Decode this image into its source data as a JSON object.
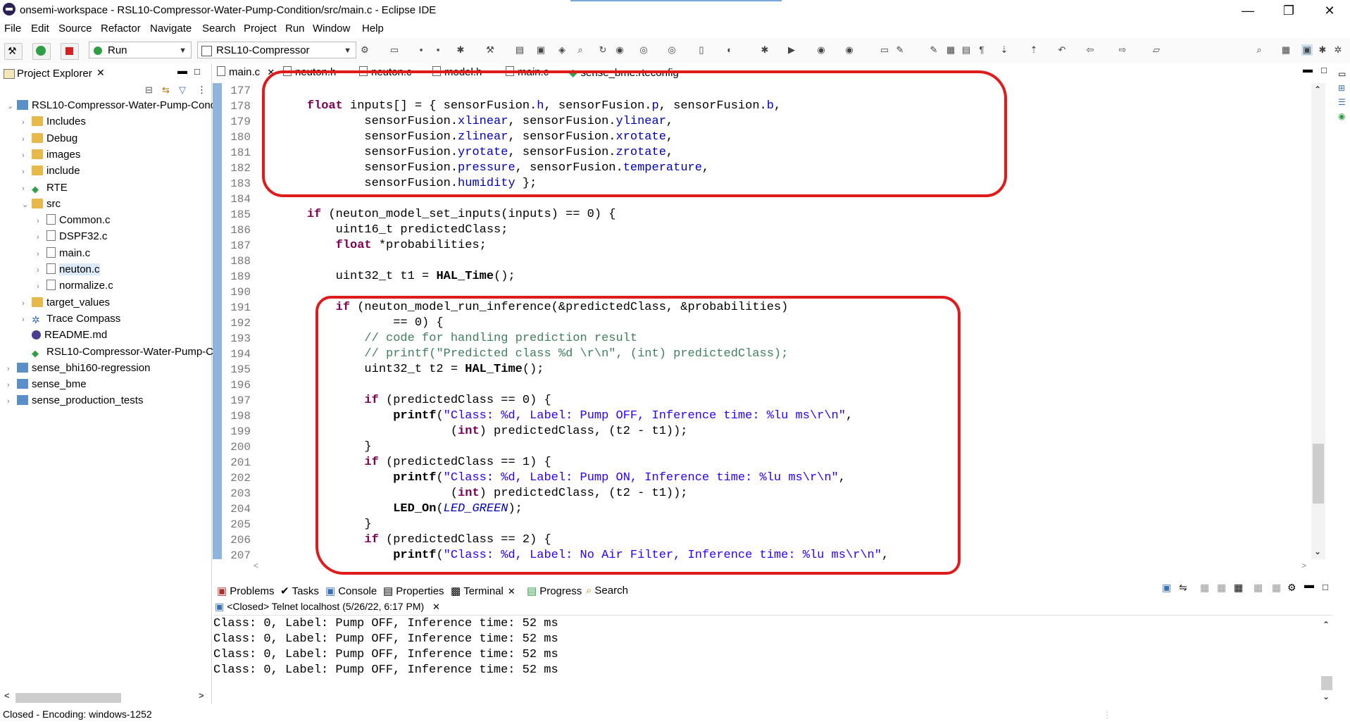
{
  "window": {
    "title": "onsemi-workspace - RSL10-Compressor-Water-Pump-Condition/src/main.c - Eclipse IDE",
    "controls": {
      "minimize": "—",
      "restore": "❐",
      "close": "✕"
    }
  },
  "menu": [
    "File",
    "Edit",
    "Source",
    "Refactor",
    "Navigate",
    "Search",
    "Project",
    "Run",
    "Window",
    "Help"
  ],
  "toolbar": {
    "run_config": "Run",
    "launch_target": "RSL10-Compressor"
  },
  "project_explorer": {
    "title": "Project Explorer",
    "items": [
      {
        "label": "RSL10-Compressor-Water-Pump-Conc",
        "kind": "project",
        "depth": 0,
        "expanded": true
      },
      {
        "label": "Includes",
        "kind": "includes",
        "depth": 1
      },
      {
        "label": "Debug",
        "kind": "folder",
        "depth": 1
      },
      {
        "label": "images",
        "kind": "folder",
        "depth": 1
      },
      {
        "label": "include",
        "kind": "folder",
        "depth": 1
      },
      {
        "label": "RTE",
        "kind": "rte",
        "depth": 1
      },
      {
        "label": "src",
        "kind": "folder",
        "depth": 1,
        "expanded": true
      },
      {
        "label": "Common.c",
        "kind": "file",
        "depth": 2
      },
      {
        "label": "DSPF32.c",
        "kind": "file",
        "depth": 2
      },
      {
        "label": "main.c",
        "kind": "file",
        "depth": 2
      },
      {
        "label": "neuton.c",
        "kind": "file",
        "depth": 2,
        "selected": true
      },
      {
        "label": "normalize.c",
        "kind": "file",
        "depth": 2
      },
      {
        "label": "target_values",
        "kind": "folder",
        "depth": 1
      },
      {
        "label": "Trace Compass",
        "kind": "trace",
        "depth": 1
      },
      {
        "label": "README.md",
        "kind": "md",
        "depth": 1
      },
      {
        "label": "RSL10-Compressor-Water-Pump-Co",
        "kind": "rteconfig",
        "depth": 1
      },
      {
        "label": "sense_bhi160-regression",
        "kind": "project",
        "depth": 0
      },
      {
        "label": "sense_bme",
        "kind": "project",
        "depth": 0
      },
      {
        "label": "sense_production_tests",
        "kind": "project",
        "depth": 0
      }
    ]
  },
  "editor_tabs": [
    "main.c",
    "neuton.h",
    "neuton.c",
    "model.h",
    "main.c",
    "sense_bme.rteconfig"
  ],
  "code_lines": [
    {
      "n": "177",
      "html": ""
    },
    {
      "n": "178",
      "html": "    <span class='kw'>float</span> inputs[] = { sensorFusion.<span class='fld'>h</span>, sensorFusion.<span class='fld'>p</span>, sensorFusion.<span class='fld'>b</span>,"
    },
    {
      "n": "179",
      "html": "            sensorFusion.<span class='fld'>xlinear</span>, sensorFusion.<span class='fld'>ylinear</span>,"
    },
    {
      "n": "180",
      "html": "            sensorFusion.<span class='fld'>zlinear</span>, sensorFusion.<span class='fld'>xrotate</span>,"
    },
    {
      "n": "181",
      "html": "            sensorFusion.<span class='fld'>yrotate</span>, sensorFusion.<span class='fld'>zrotate</span>,"
    },
    {
      "n": "182",
      "html": "            sensorFusion.<span class='fld'>pressure</span>, sensorFusion.<span class='fld'>temperature</span>,"
    },
    {
      "n": "183",
      "html": "            sensorFusion.<span class='fld'>humidity</span> };"
    },
    {
      "n": "184",
      "html": ""
    },
    {
      "n": "185",
      "html": "    <span class='kw'>if</span> (neuton_model_set_inputs(inputs) == 0) {"
    },
    {
      "n": "186",
      "html": "        uint16_t predictedClass;"
    },
    {
      "n": "187",
      "html": "        <span class='kw'>float</span> *probabilities;"
    },
    {
      "n": "188",
      "html": ""
    },
    {
      "n": "189",
      "html": "        uint32_t t1 = <span class='fn'>HAL_Time</span>();"
    },
    {
      "n": "190",
      "html": ""
    },
    {
      "n": "191",
      "html": "        <span class='kw'>if</span> (neuton_model_run_inference(&amp;predictedClass, &amp;probabilities)"
    },
    {
      "n": "192",
      "html": "                == 0) {"
    },
    {
      "n": "193",
      "html": "            <span class='cmt'>// code for handling prediction result</span>"
    },
    {
      "n": "194",
      "html": "            <span class='cmt'>// printf(\"Predicted class %d \\r\\n\", (int) predictedClass);</span>"
    },
    {
      "n": "195",
      "html": "            uint32_t t2 = <span class='fn'>HAL_Time</span>();"
    },
    {
      "n": "196",
      "html": ""
    },
    {
      "n": "197",
      "html": "            <span class='kw'>if</span> (predictedClass == 0) {"
    },
    {
      "n": "198",
      "html": "                <span class='fn'>printf</span>(<span class='str'>\"Class: %d, Label: Pump OFF, Inference time: %lu ms\\r\\n\"</span>,"
    },
    {
      "n": "199",
      "html": "                        (<span class='kw'>int</span>) predictedClass, (t2 - t1));"
    },
    {
      "n": "200",
      "html": "            }"
    },
    {
      "n": "201",
      "html": "            <span class='kw'>if</span> (predictedClass == 1) {"
    },
    {
      "n": "202",
      "html": "                <span class='fn'>printf</span>(<span class='str'>\"Class: %d, Label: Pump ON, Inference time: %lu ms\\r\\n\"</span>,"
    },
    {
      "n": "203",
      "html": "                        (<span class='kw'>int</span>) predictedClass, (t2 - t1));"
    },
    {
      "n": "204",
      "html": "                <span class='fn'>LED_On</span>(<span class='it'>LED_GREEN</span>);"
    },
    {
      "n": "205",
      "html": "            }"
    },
    {
      "n": "206",
      "html": "            <span class='kw'>if</span> (predictedClass == 2) {"
    },
    {
      "n": "207",
      "html": "                <span class='fn'>printf</span>(<span class='str'>\"Class: %d, Label: No Air Filter, Inference time: %lu ms\\r\\n\"</span>,"
    }
  ],
  "bottom_tabs": [
    "Problems",
    "Tasks",
    "Console",
    "Properties",
    "Terminal",
    "Progress",
    "Search"
  ],
  "terminal": {
    "header": "<Closed> Telnet localhost (5/26/22, 6:17 PM)",
    "lines": [
      "Class: 0, Label: Pump OFF, Inference time: 52 ms",
      "Class: 0, Label: Pump OFF, Inference time: 52 ms",
      "Class: 0, Label: Pump OFF, Inference time: 52 ms",
      "Class: 0, Label: Pump OFF, Inference time: 52 ms"
    ]
  },
  "status": "Closed - Encoding: windows-1252",
  "colors": {
    "annotation": "#e01b1b",
    "keyword": "#7f0055",
    "field": "#0000c0",
    "string": "#2a00ff",
    "comment": "#3f7f5f"
  }
}
